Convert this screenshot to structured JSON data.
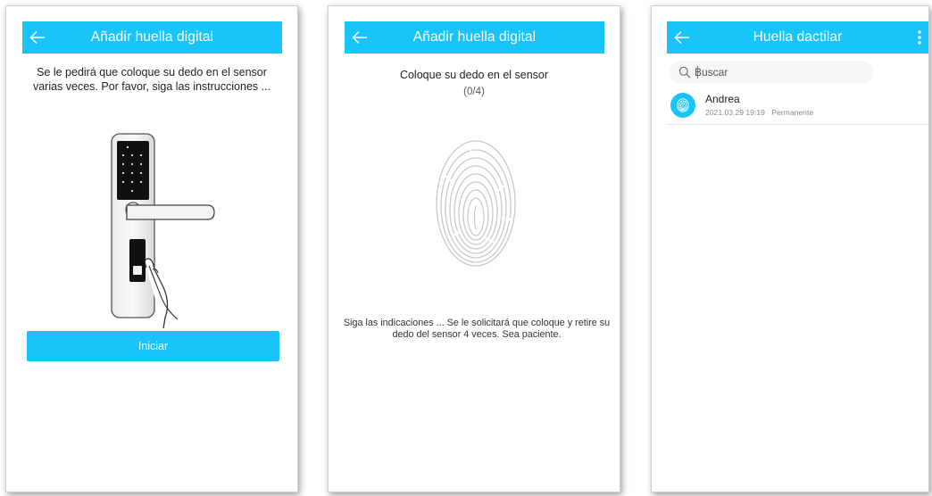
{
  "screen1": {
    "title": "Añadir huella digital",
    "intro": "Se le pedirá que coloque su dedo en el sensor varias veces. Por favor, siga las instrucciones ...",
    "start_button": "Iniciar",
    "illustration_icon": "door-lock-with-hand-icon"
  },
  "screen2": {
    "title": "Añadir huella digital",
    "instruction": "Coloque su dedo en el sensor",
    "progress": "(0/4)",
    "hint": "Siga las indicaciones ... Se le solicitará que coloque y retire su dedo del sensor 4 veces. Sea paciente.",
    "fingerprint_icon": "fingerprint-icon"
  },
  "screen3": {
    "title": "Huella dactilar",
    "search": {
      "placeholder": "Buscar",
      "value": ""
    },
    "items": [
      {
        "name": "Andrea",
        "date": "2021.03.29 19:19",
        "validity": "Permanente",
        "icon": "fingerprint-icon"
      }
    ]
  },
  "colors": {
    "accent": "#19c4fb",
    "text": "#222222",
    "muted": "#8a8a8a"
  },
  "icons": {
    "back": "arrow-left-icon",
    "more": "more-vertical-icon",
    "search": "search-icon"
  }
}
